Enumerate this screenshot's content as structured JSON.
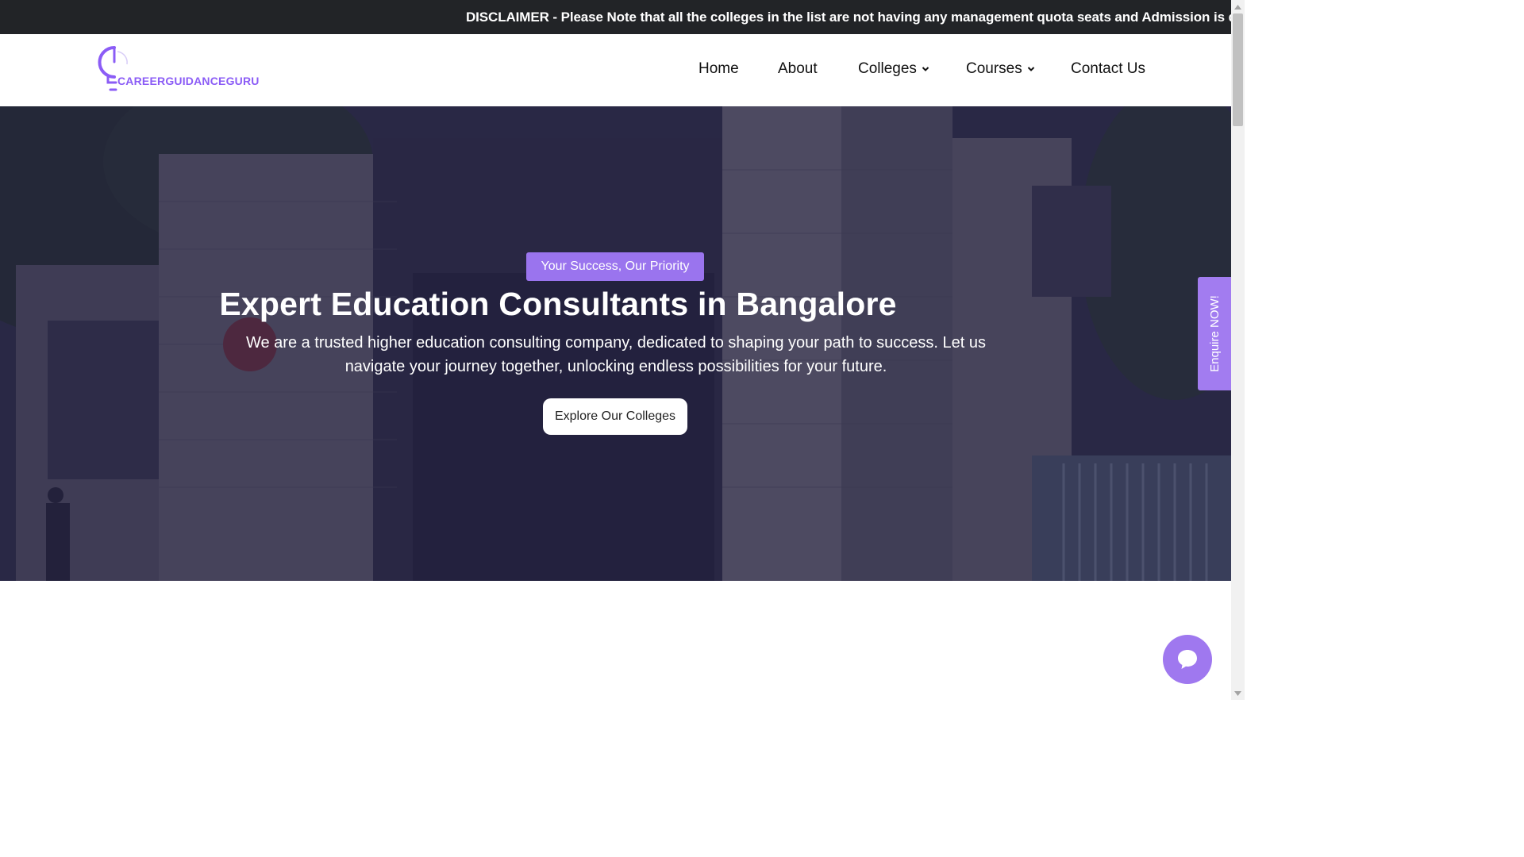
{
  "disclaimer": {
    "text": "DISCLAIMER - Please Note that all the colleges in the list are not having any management quota seats and Admission is done stri"
  },
  "logo": {
    "text": "CAREERGUIDANCEGURU",
    "brand_color": "#8b5cf6"
  },
  "nav": {
    "items": [
      {
        "label": "Home",
        "has_dropdown": false
      },
      {
        "label": "About",
        "has_dropdown": false
      },
      {
        "label": "Colleges",
        "has_dropdown": true
      },
      {
        "label": "Courses",
        "has_dropdown": true
      },
      {
        "label": "Contact Us",
        "has_dropdown": false
      }
    ]
  },
  "hero": {
    "tagline": "Your Success, Our Priority",
    "title": "Expert Education Consultants in Bangalore",
    "description": "We are a trusted higher education consulting company, dedicated to shaping your path to success. Let us navigate your journey together, unlocking endless possibilities for your future.",
    "cta_label": "Explore Our Colleges",
    "accent_color": "#9a74ee"
  },
  "enquire": {
    "label": "Enquire NOW!"
  },
  "chat": {
    "icon": "chat-bubble-icon"
  }
}
